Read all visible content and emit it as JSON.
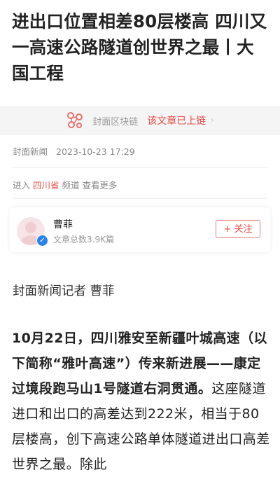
{
  "article": {
    "title": "进出口位置相差80层楼高 四川又一高速公路隧道创世界之最丨大国工程",
    "chain": {
      "label": "封面区块链",
      "status": "该文章已上链",
      "icon": "blockchain-icon"
    },
    "meta": {
      "source": "封面新闻",
      "datetime": "2023-10-23 17:29"
    },
    "channel": {
      "prefix": "进入",
      "province": "四川省",
      "suffix": "频道 查看更多"
    },
    "author": {
      "name": "曹菲",
      "count_text": "文章总数3.9K篇",
      "verified_icon": "verified-icon",
      "follow_label": "+ 关注"
    },
    "reporter_line": "封面新闻记者 曹菲",
    "body": {
      "lead": "10月22日，四川雅安至新疆叶城高速（以下简称“雅叶高速”）传来新进展——康定过境段跑马山1号隧道右洞贯通。",
      "text": "这座隧道进口和出口的高差达到222米，相当于80层楼高，创下高速公路单体隧道进出口高差世界之最。除此"
    }
  },
  "colors": {
    "accent": "#e44b47",
    "muted": "#888888",
    "verified": "#2a84e8"
  }
}
